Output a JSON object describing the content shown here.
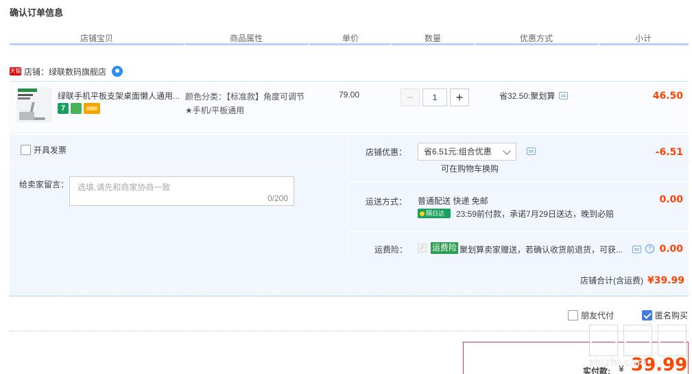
{
  "page": {
    "title": "确认订单信息"
  },
  "columns": [
    "店铺宝贝",
    "商品属性",
    "单价",
    "数量",
    "优惠方式",
    "小计"
  ],
  "shop": {
    "tmall_badge": "天猫",
    "label": "店铺：绿联数码旗舰店"
  },
  "item": {
    "title": "绿联手机平板支架桌面懒人通用...",
    "attr_line1": "颜色分类：【标准款】角度可调节",
    "attr_line2": "★手机/平板通用",
    "unit_price": "79.00",
    "quantity": "1",
    "minus": "−",
    "plus": "+",
    "discount": "省32.50:聚划算",
    "subtotal": "46.50",
    "badge_7": "7"
  },
  "invoice": {
    "label": "开具发票"
  },
  "message": {
    "label": "给卖家留言：",
    "placeholder": "选填,请先和商家协商一致",
    "counter": "0/200"
  },
  "shop_discount": {
    "label": "店铺优惠：",
    "selected": "省6.51元:组合优惠",
    "swap_hint": "可在购物车换购",
    "value": "-6.51"
  },
  "shipping": {
    "label": "运送方式：",
    "method": "普通配送 快递 免邮",
    "next_day_tag": "隔日达",
    "promise": "23:59前付款，承诺7月29日送达，晚到必赔",
    "value": "0.00"
  },
  "insurance": {
    "label": "运费险：",
    "check": "✓",
    "tag": "运费险",
    "desc": "聚划算卖家赠送，若确认收货前退货，可获...",
    "help": "?",
    "value": "0.00"
  },
  "shop_total": {
    "label": "店铺合计(含运费)",
    "value": "¥39.99"
  },
  "options": {
    "friend_pay": "朋友代付",
    "anonymous": "匿名购买"
  },
  "payment": {
    "label": "实付款:",
    "currency": "¥",
    "amount": "39.99"
  },
  "watermark": {
    "text": "zhizhi.com"
  },
  "colors": {
    "accent": "#ff4400",
    "blue_line": "#b2d1ff",
    "pane_bg": "#f2f7ff"
  },
  "icons": [
    "tmall-icon",
    "wangwang-icon",
    "msg-icon",
    "help-icon",
    "chevron-down-icon"
  ]
}
